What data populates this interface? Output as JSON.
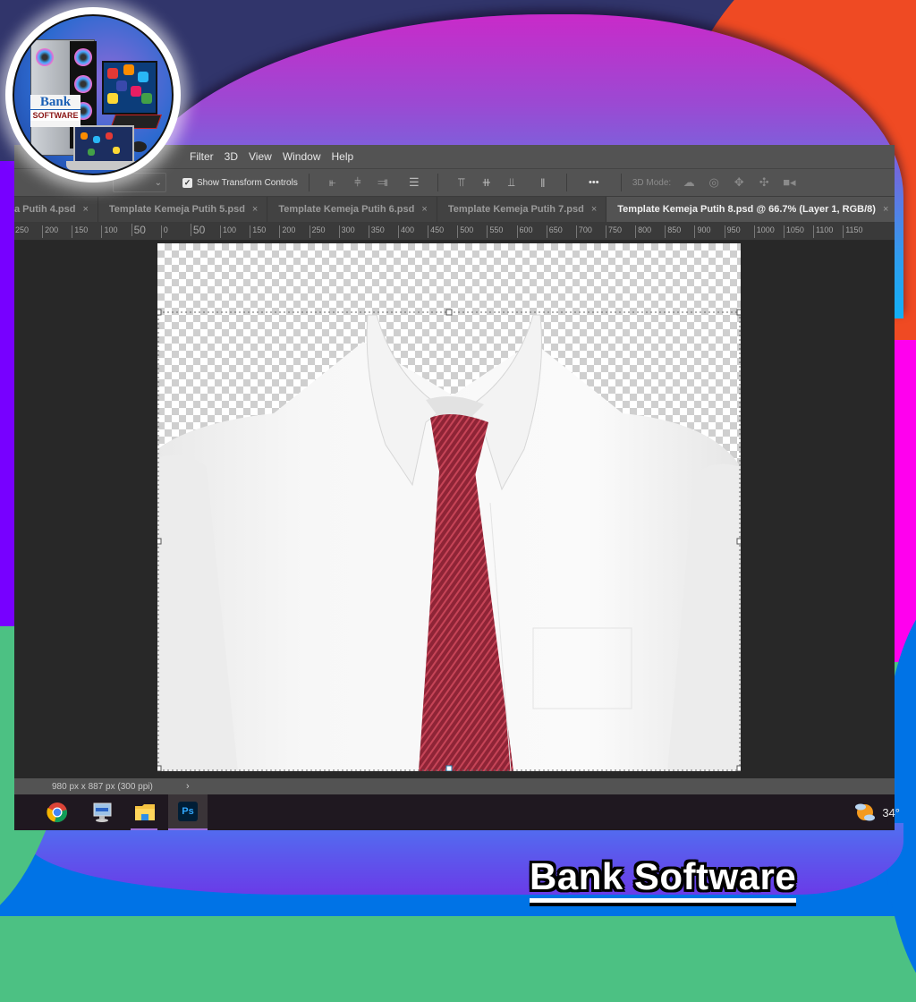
{
  "branding": {
    "logo_top": "Bank",
    "logo_bottom": "SOFTWARE",
    "caption": "Bank Software",
    "colors": {
      "orange": "#ef4a23",
      "navy": "#31356b",
      "violet": "#7700ff",
      "magenta": "#ff00ee",
      "blue": "#0073e6",
      "green": "#4cc183"
    }
  },
  "app": {
    "menu": [
      "Filter",
      "3D",
      "View",
      "Window",
      "Help"
    ],
    "options_bar": {
      "show_transform_controls": {
        "label": "Show Transform Controls",
        "checked": true
      },
      "more_label": "•••",
      "mode_label": "3D Mode:",
      "align_icons": [
        "align-left-edges-icon",
        "align-horizontal-centers-icon",
        "align-right-edges-icon",
        "distribute-horizontal-icon"
      ],
      "distribute_icons": [
        "align-top-edges-icon",
        "align-vertical-centers-icon",
        "align-bottom-edges-icon",
        "distribute-vertical-icon"
      ],
      "mode_icons": [
        "orbit-3d-icon",
        "roll-3d-icon",
        "drag-3d-icon",
        "slide-3d-icon",
        "scale-3d-camera-icon"
      ]
    },
    "tabs": [
      {
        "label": "a Putih 4.psd",
        "active": false
      },
      {
        "label": "Template Kemeja Putih 5.psd",
        "active": false
      },
      {
        "label": "Template Kemeja Putih 6.psd",
        "active": false
      },
      {
        "label": "Template Kemeja Putih 7.psd",
        "active": false
      },
      {
        "label": "Template Kemeja Putih 8.psd @ 66.7% (Layer 1, RGB/8)",
        "active": true
      }
    ],
    "tab_close_glyph": "×",
    "ruler": [
      "250",
      "200",
      "150",
      "100",
      "50",
      "0",
      "50",
      "100",
      "150",
      "200",
      "250",
      "300",
      "350",
      "400",
      "450",
      "500",
      "550",
      "600",
      "650",
      "700",
      "750",
      "800",
      "850",
      "900",
      "950",
      "1000",
      "1050",
      "1100",
      "1150"
    ],
    "status": {
      "doc_size": "980 px x 887 px (300 ppi)",
      "arrow": "›"
    }
  },
  "taskbar": {
    "items": [
      {
        "name": "chrome",
        "icon": "chrome-icon",
        "active": false
      },
      {
        "name": "remote-desktop",
        "icon": "computer-network-icon",
        "active": false
      },
      {
        "name": "file-explorer",
        "icon": "folder-icon",
        "active": false,
        "open": true
      },
      {
        "name": "photoshop",
        "icon": "photoshop-icon",
        "label": "Ps",
        "active": true
      }
    ],
    "weather": {
      "icon": "partly-cloudy-icon",
      "temperature": "34°"
    }
  }
}
